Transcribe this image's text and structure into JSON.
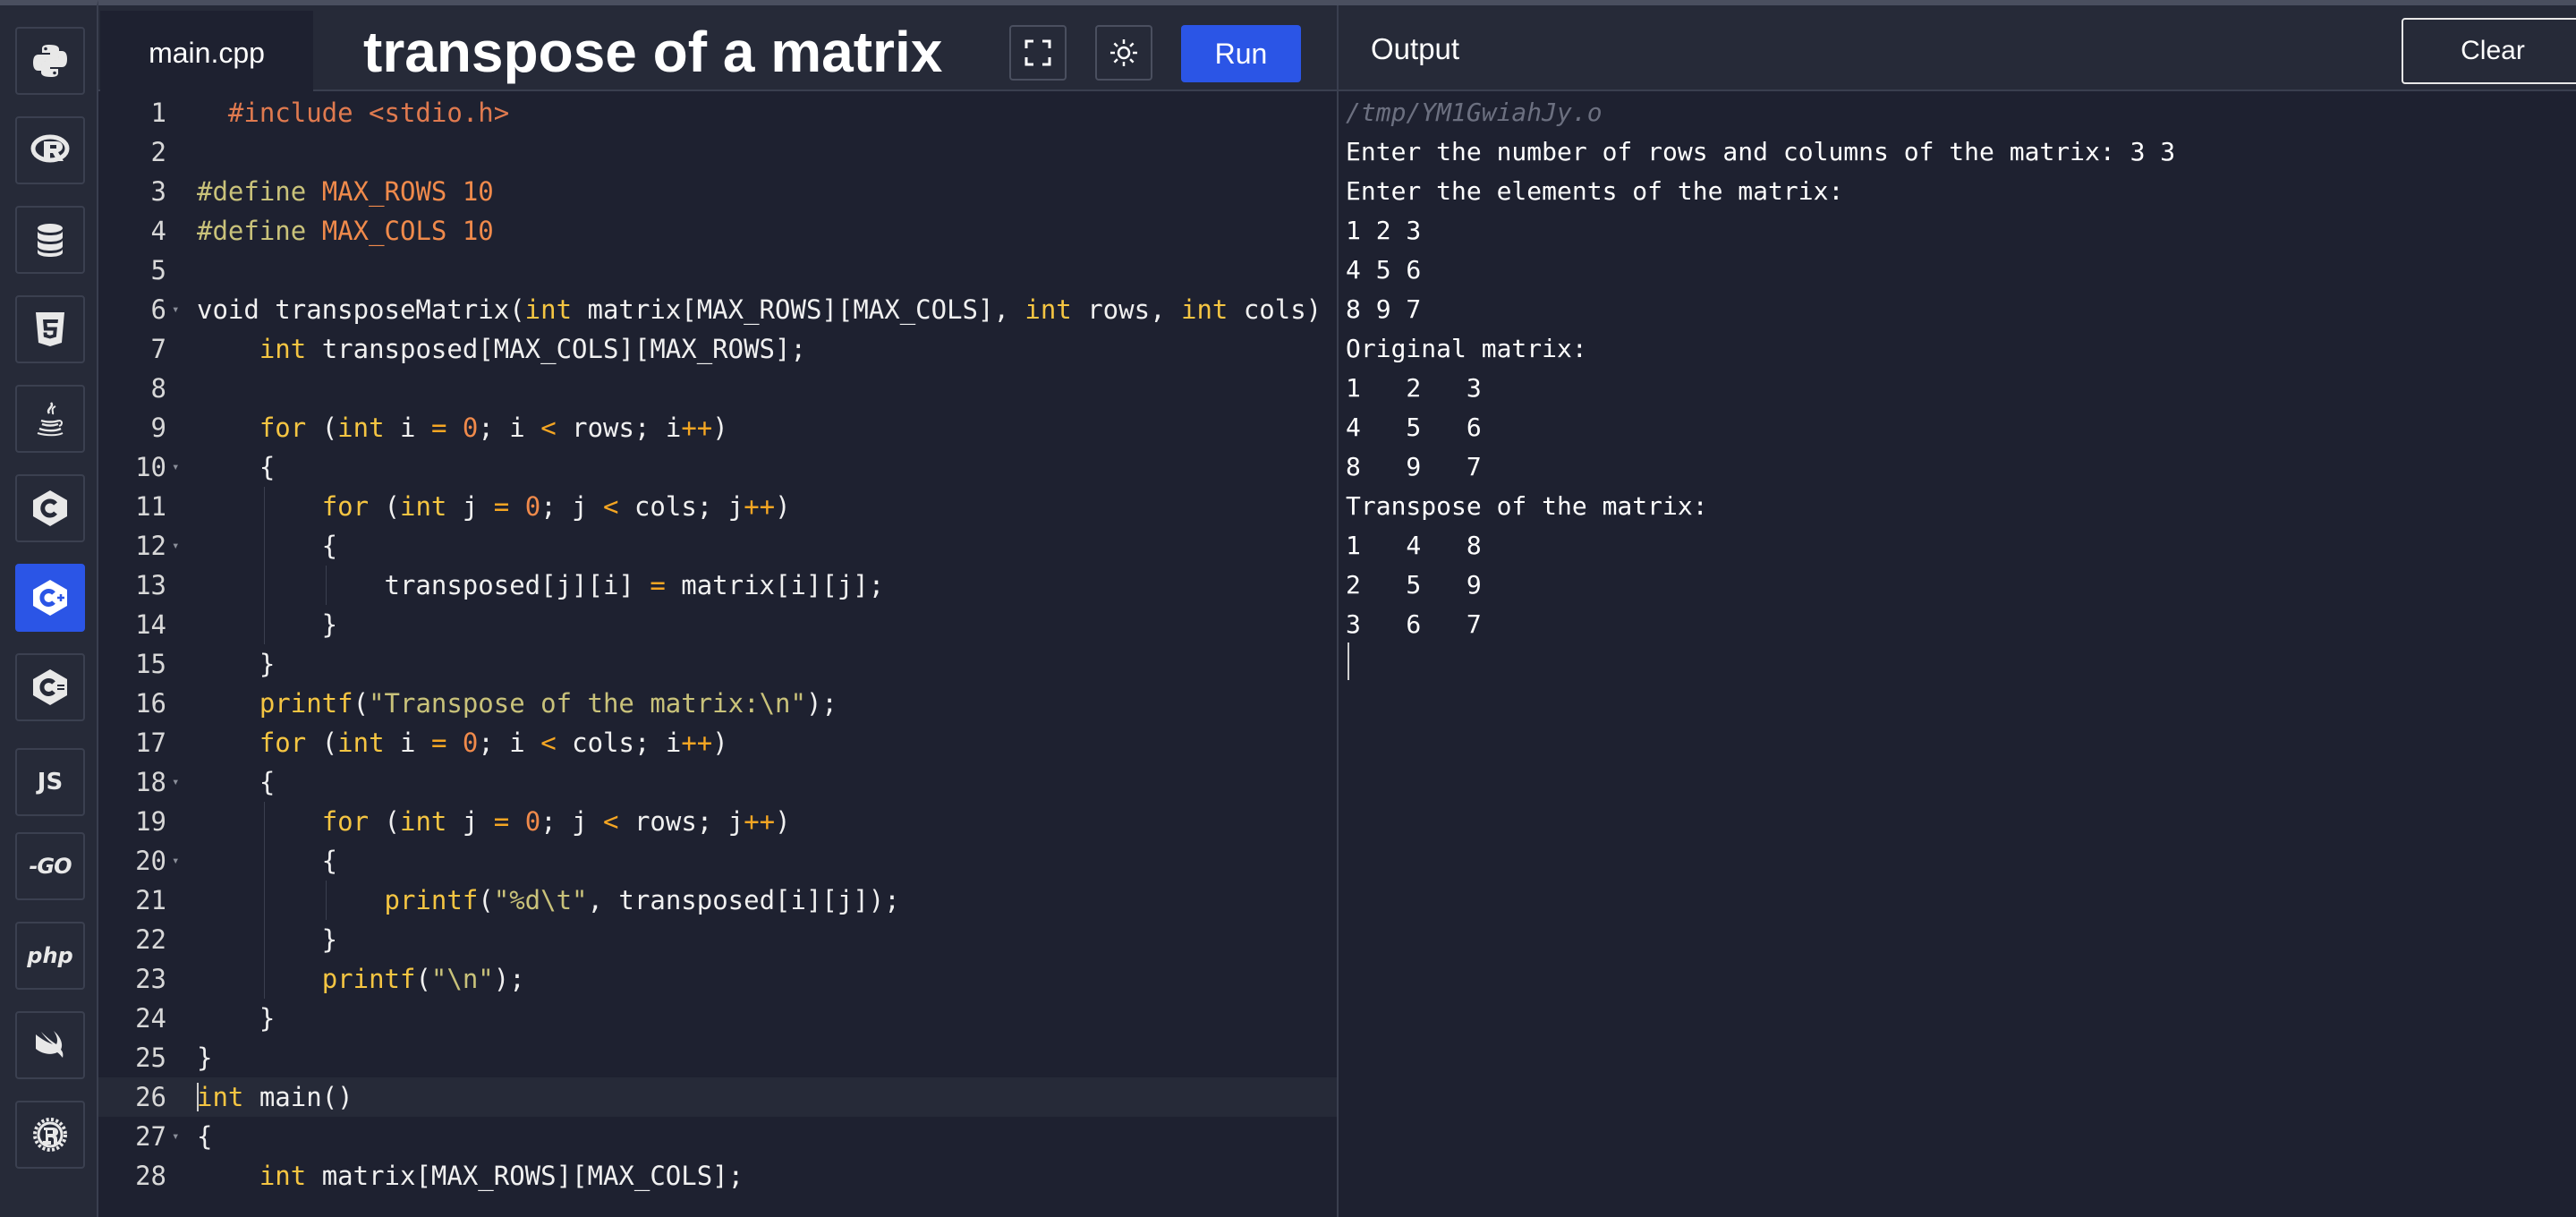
{
  "sidebar": {
    "items": [
      {
        "name": "python",
        "icon": "python-icon"
      },
      {
        "name": "r",
        "icon": "r-icon"
      },
      {
        "name": "sql",
        "icon": "database-icon"
      },
      {
        "name": "html",
        "icon": "html5-icon"
      },
      {
        "name": "java",
        "icon": "java-icon"
      },
      {
        "name": "c",
        "icon": "c-icon"
      },
      {
        "name": "cpp",
        "icon": "cpp-icon",
        "active": true
      },
      {
        "name": "csharp",
        "icon": "csharp-icon"
      },
      {
        "name": "javascript",
        "icon": "js-icon",
        "label": "JS"
      },
      {
        "name": "go",
        "icon": "go-icon",
        "label": "-GO"
      },
      {
        "name": "php",
        "icon": "php-icon",
        "label": "php"
      },
      {
        "name": "swift",
        "icon": "swift-icon"
      },
      {
        "name": "rust",
        "icon": "rust-icon"
      }
    ]
  },
  "toolbar": {
    "file_tab": "main.cpp",
    "title": "transpose of a matrix",
    "fullscreen_icon": "fullscreen-icon",
    "theme_icon": "sun-icon",
    "run_label": "Run",
    "output_label": "Output",
    "clear_label": "Clear"
  },
  "colors": {
    "accent": "#2b55e6",
    "background": "#1e2130",
    "panel": "#262a38",
    "keyword": "#f5c542",
    "number": "#f08a4b",
    "string": "#c9c27a"
  },
  "editor": {
    "active_line": 26,
    "lines": [
      "  #include <stdio.h>",
      "",
      "#define MAX_ROWS 10",
      "#define MAX_COLS 10",
      "",
      "void transposeMatrix(int matrix[MAX_ROWS][MAX_COLS], int rows, int cols) {",
      "    int transposed[MAX_COLS][MAX_ROWS];",
      "",
      "    for (int i = 0; i < rows; i++)",
      "    {",
      "        for (int j = 0; j < cols; j++)",
      "        {",
      "            transposed[j][i] = matrix[i][j];",
      "        }",
      "    }",
      "    printf(\"Transpose of the matrix:\\n\");",
      "    for (int i = 0; i < cols; i++)",
      "    {",
      "        for (int j = 0; j < rows; j++)",
      "        {",
      "            printf(\"%d\\t\", transposed[i][j]);",
      "        }",
      "        printf(\"\\n\");",
      "    }",
      "}",
      "int main()",
      "{",
      "    int matrix[MAX_ROWS][MAX_COLS];"
    ],
    "fold_lines": [
      6,
      10,
      12,
      18,
      20,
      27
    ]
  },
  "output": {
    "path": "/tmp/YM1GwiahJy.o",
    "lines": [
      "Enter the number of rows and columns of the matrix: 3 3",
      "Enter the elements of the matrix:",
      "1 2 3",
      "4 5 6",
      "8 9 7",
      "Original matrix:",
      "1   2   3",
      "4   5   6",
      "8   9   7",
      "Transpose of the matrix:",
      "1   4   8",
      "2   5   9",
      "3   6   7"
    ]
  }
}
